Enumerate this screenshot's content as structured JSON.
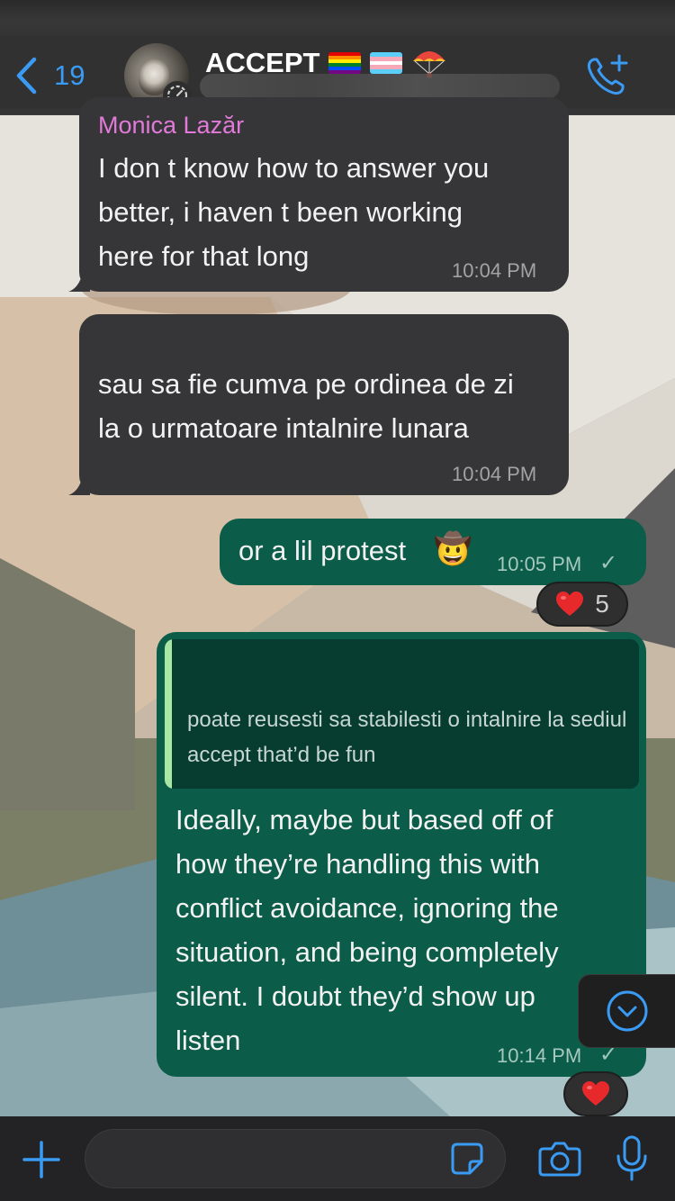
{
  "header": {
    "back_count": "19",
    "group_name": "ACCEPT"
  },
  "messages": [
    {
      "direction": "incoming",
      "sender": "Monica Lazăr",
      "text": "I don t know how to answer you\nbetter, i haven t been working\nhere for that long",
      "time": "10:04 PM"
    },
    {
      "direction": "incoming",
      "text": "sau sa fie cumva pe ordinea de zi\nla o urmatoare intalnire lunara",
      "time": "10:04 PM"
    },
    {
      "direction": "outgoing",
      "text": "or a lil protest",
      "emoji": "🤠",
      "time": "10:05 PM",
      "status_tick": "✓",
      "reaction": {
        "emoji": "heart",
        "count": "5"
      }
    },
    {
      "direction": "outgoing",
      "quoted_text": "poate reusesti sa stabilesti o intalnire la sediul accept that’d be fun",
      "text": "Ideally, maybe but based off of\nhow they’re handling this with\nconflict avoidance, ignoring the\nsituation, and being completely\nsilent. I doubt they’d show up\nlisten",
      "time": "10:14 PM",
      "status_tick": "✓",
      "reaction": {
        "emoji": "heart"
      }
    }
  ],
  "colors": {
    "incoming_bubble": "#363638",
    "outgoing_bubble": "#0b5c48",
    "sender_name": "#e17ad9",
    "accent": "#3a9bf5",
    "quote_bar": "#a8e6a3"
  },
  "icons": {
    "back": "chevron-left-icon",
    "call": "phone-add-icon",
    "scroll_down": "chevron-down-circle-icon",
    "attach": "plus-icon",
    "sticker": "sticker-icon",
    "camera": "camera-icon",
    "mic": "microphone-icon"
  }
}
